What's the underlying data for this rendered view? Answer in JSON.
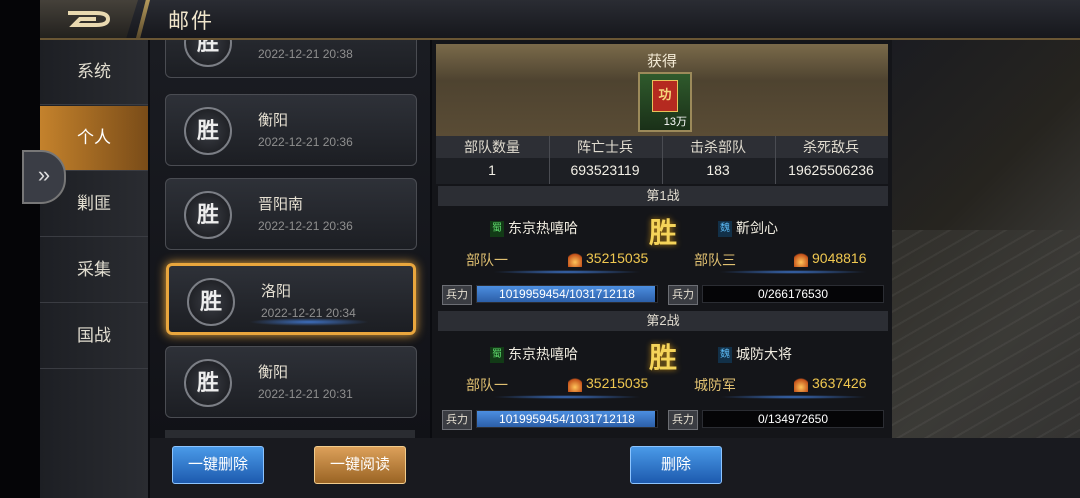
{
  "header": {
    "title": "邮件"
  },
  "nav": {
    "items": [
      "系统",
      "个人",
      "剿匪",
      "采集",
      "国战"
    ],
    "active": "个人"
  },
  "mail_list": {
    "items": [
      {
        "badge": "胜",
        "place": "",
        "date": "2022-12-21   20:38"
      },
      {
        "badge": "胜",
        "place": "衡阳",
        "date": "2022-12-21   20:36"
      },
      {
        "badge": "胜",
        "place": "晋阳南",
        "date": "2022-12-21   20:36"
      },
      {
        "badge": "胜",
        "place": "洛阳",
        "date": "2022-12-21   20:34",
        "selected": true
      },
      {
        "badge": "胜",
        "place": "衡阳",
        "date": "2022-12-21   20:31"
      }
    ]
  },
  "reward": {
    "label": "获得",
    "item_icon": "merit-medal-icon",
    "item_glyph": "功",
    "item_qty": "13万"
  },
  "stats": {
    "headers": [
      "部队数量",
      "阵亡士兵",
      "击杀部队",
      "杀死敌兵"
    ],
    "values": [
      "1",
      "693523119",
      "183",
      "19625506236"
    ]
  },
  "battles": [
    {
      "title": "第1战",
      "result": "胜",
      "left": {
        "faction": "蜀",
        "name": "东京热嘻哈",
        "troop": "部队一",
        "power": "35215035",
        "hp_label": "兵力",
        "hp_text": "1019959454/1031712118",
        "hp_fraction": 0.989
      },
      "right": {
        "faction": "魏",
        "name": "靳剑心",
        "troop": "部队三",
        "power": "9048816",
        "hp_label": "兵力",
        "hp_text": "0/266176530",
        "hp_fraction": 0
      }
    },
    {
      "title": "第2战",
      "result": "胜",
      "left": {
        "faction": "蜀",
        "name": "东京热嘻哈",
        "troop": "部队一",
        "power": "35215035",
        "hp_label": "兵力",
        "hp_text": "1019959454/1031712118",
        "hp_fraction": 0.989
      },
      "right": {
        "faction": "魏",
        "name": "城防大将",
        "troop": "城防军",
        "power": "3637426",
        "hp_label": "兵力",
        "hp_text": "0/134972650",
        "hp_fraction": 0
      }
    }
  ],
  "footer": {
    "delete_all": "一键删除",
    "read_all": "一键阅读",
    "delete": "删除"
  },
  "colors": {
    "accent_gold": "#e9a63d",
    "button_blue": "#1d5aae",
    "victory_gold": "#f5d45a"
  }
}
